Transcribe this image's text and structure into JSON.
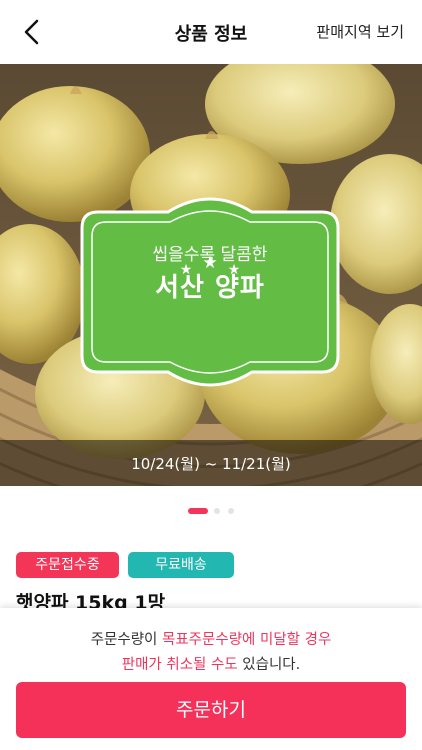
{
  "header": {
    "title": "상품 정보",
    "action": "판매지역 보기"
  },
  "hero": {
    "tagline": "씹을수록 달콤한",
    "title": "서산 양파",
    "period": "10/24(월) ~ 11/21(월)",
    "carousel": {
      "total": 3,
      "active": 1
    }
  },
  "tags": {
    "status": "주문접수중",
    "shipping": "무료배송"
  },
  "product": {
    "name": "햇양파 15kg 1망"
  },
  "notice": {
    "line1_part1": "주문수량이 ",
    "line1_highlight": "목표주문수량에 미달할 경우",
    "line2_highlight": "판매가 취소될 수도",
    "line2_part2": " 있습니다."
  },
  "order_button": "주문하기",
  "colors": {
    "brand_red": "#f53159",
    "tag_red": "#f33558",
    "tag_teal": "#22b7b1",
    "badge_green": "#63bd45"
  }
}
